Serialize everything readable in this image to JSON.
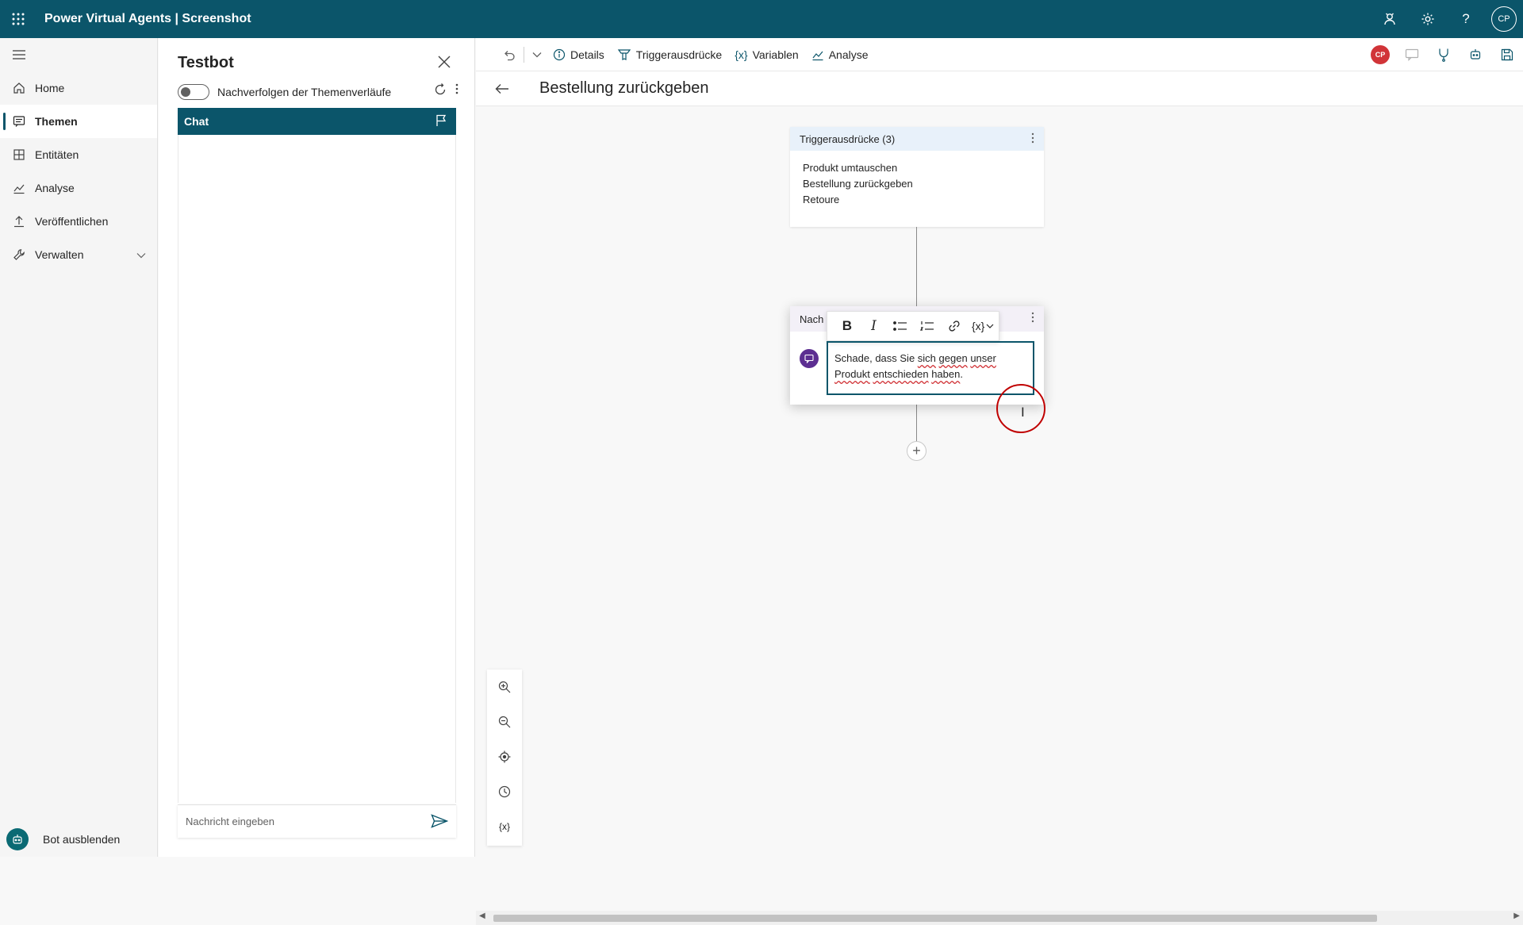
{
  "app": {
    "title": "Power Virtual Agents | Screenshot",
    "user_initials": "CP"
  },
  "nav": {
    "items": [
      {
        "label": "Home",
        "icon": "home-icon"
      },
      {
        "label": "Themen",
        "icon": "chat-icon",
        "active": true
      },
      {
        "label": "Entitäten",
        "icon": "entities-icon"
      },
      {
        "label": "Analyse",
        "icon": "chart-icon"
      },
      {
        "label": "Veröffentlichen",
        "icon": "upload-icon"
      },
      {
        "label": "Verwalten",
        "icon": "wrench-icon",
        "expandable": true
      }
    ],
    "bot_hide_label": "Bot ausblenden"
  },
  "testbot": {
    "title": "Testbot",
    "toggle_label": "Nachverfolgen der Themenverläufe",
    "toggle_on": false,
    "chat_tab": "Chat",
    "input_placeholder": "Nachricht eingeben"
  },
  "commandbar": {
    "details": "Details",
    "triggers": "Triggerausdrücke",
    "variables_icon": "{x}",
    "variables": "Variablen",
    "analyse": "Analyse",
    "author_initials": "CP"
  },
  "topic": {
    "title": "Bestellung zurückgeben"
  },
  "trigger_node": {
    "header": "Triggerausdrücke (3)",
    "phrases": [
      "Produkt umtauschen",
      "Bestellung zurückgeben",
      "Retoure"
    ]
  },
  "message_node": {
    "header": "Nachricht",
    "header_visible": "Nach",
    "toolbar": {
      "bold": "B",
      "italic": "I",
      "variable": "{x}"
    },
    "text_line1_parts": [
      "Schade, dass Sie ",
      "sich",
      " ",
      "gegen",
      " ",
      "unser"
    ],
    "text_line2_parts": [
      "Produkt",
      " ",
      "entschieden",
      " ",
      "haben",
      "."
    ]
  },
  "zoom_controls": {
    "variable_label": "{x}"
  },
  "colors": {
    "brand": "#0b556a",
    "message_icon": "#5c2e91",
    "avatar_red": "#d13438"
  }
}
